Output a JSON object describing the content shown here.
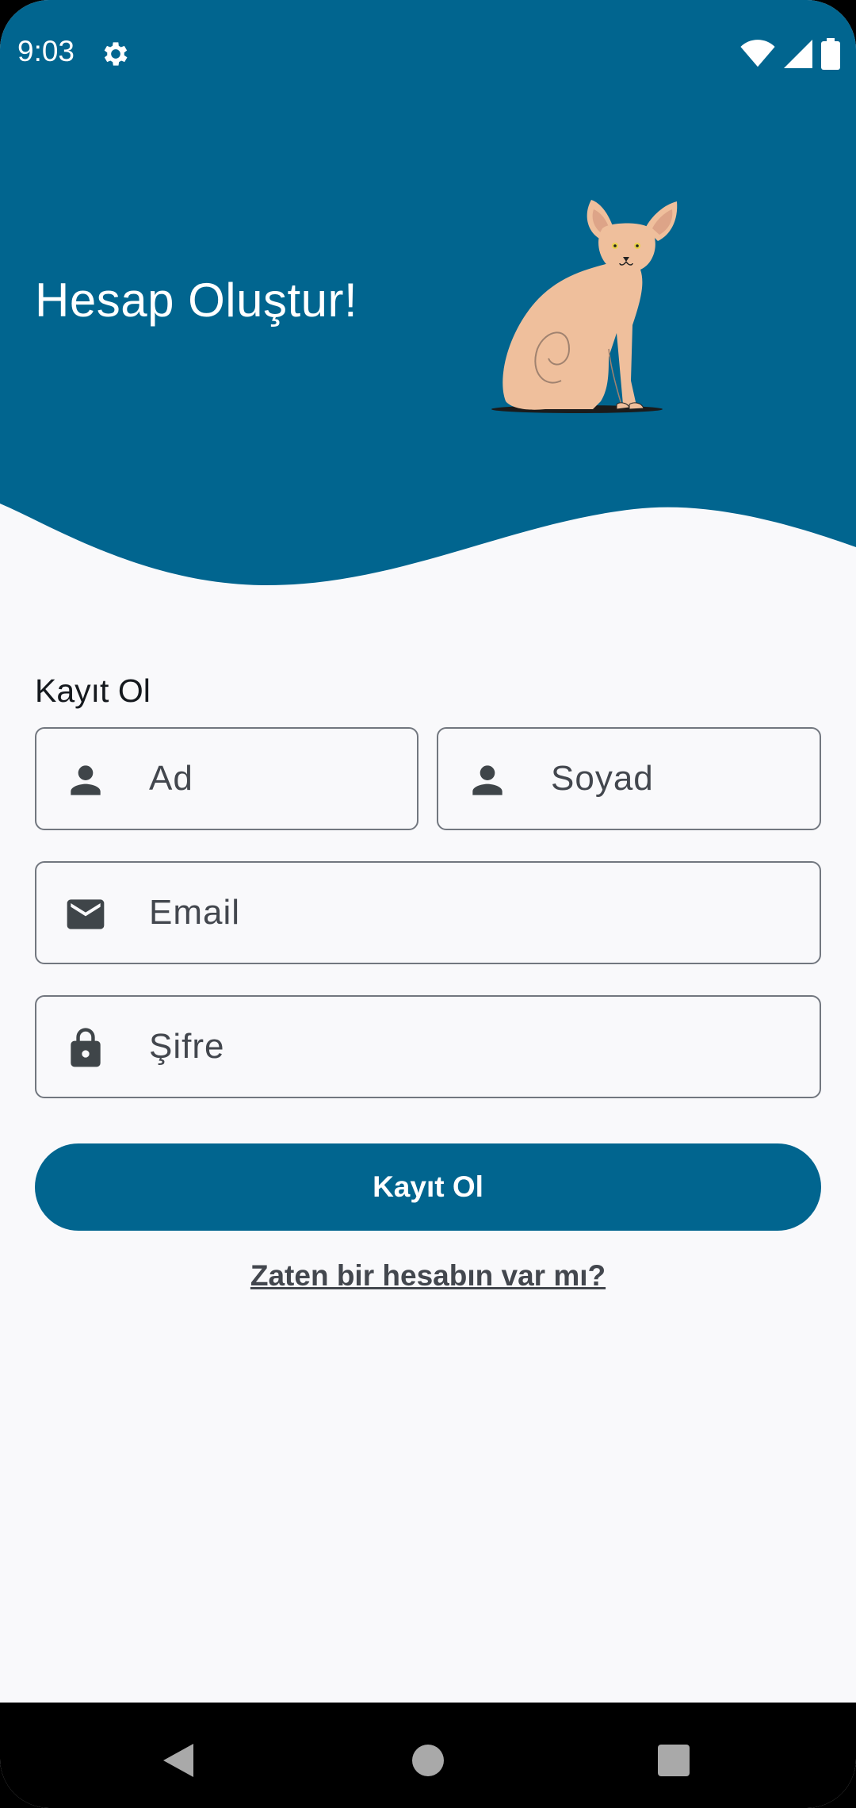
{
  "status_bar": {
    "time": "9:03",
    "icons": [
      "settings-gear-icon",
      "wifi-icon",
      "signal-icon",
      "battery-icon"
    ]
  },
  "header": {
    "title": "Hesap Oluştur!",
    "illustration": "sphynx-cat-illustration"
  },
  "form": {
    "section_title": "Kayıt Ol",
    "first_name_placeholder": "Ad",
    "last_name_placeholder": "Soyad",
    "email_placeholder": "Email",
    "password_placeholder": "Şifre",
    "submit_label": "Kayıt Ol",
    "login_link": "Zaten bir hesabın var mı?"
  },
  "nav_bar": {
    "buttons": [
      "back-icon",
      "home-icon",
      "recents-icon"
    ]
  },
  "colors": {
    "primary": "#01658f",
    "background": "#f9f9fb",
    "outline": "#72777f",
    "on_surface_variant": "#43474e",
    "cat_skin": "#efbf9c"
  }
}
